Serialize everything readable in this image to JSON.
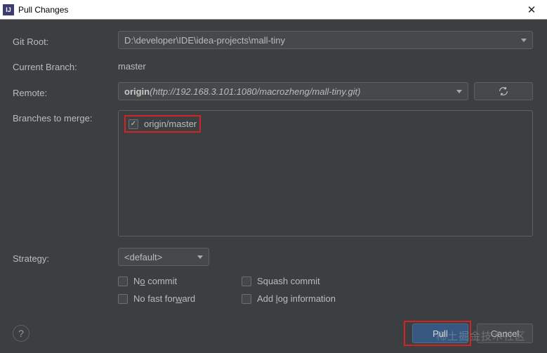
{
  "window": {
    "title": "Pull Changes",
    "icon_label": "IJ"
  },
  "form": {
    "git_root_label": "Git Root:",
    "git_root_value": "D:\\developer\\IDE\\idea-projects\\mall-tiny",
    "current_branch_label": "Current Branch:",
    "current_branch_value": "master",
    "remote_label": "Remote:",
    "remote_name": "origin",
    "remote_url": "(http://192.168.3.101:1080/macrozheng/mall-tiny.git)",
    "branches_label": "Branches to merge:",
    "branches": [
      {
        "label": "origin/master",
        "checked": true
      }
    ],
    "strategy_label": "Strategy:",
    "strategy_value": "<default>",
    "options": {
      "no_commit": "No commit",
      "squash_commit": "Squash commit",
      "no_ff": "No fast forward",
      "add_log": "Add log information"
    }
  },
  "buttons": {
    "pull": "Pull",
    "cancel": "Cancel",
    "help": "?"
  },
  "watermark": "稀土掘金技术社区"
}
